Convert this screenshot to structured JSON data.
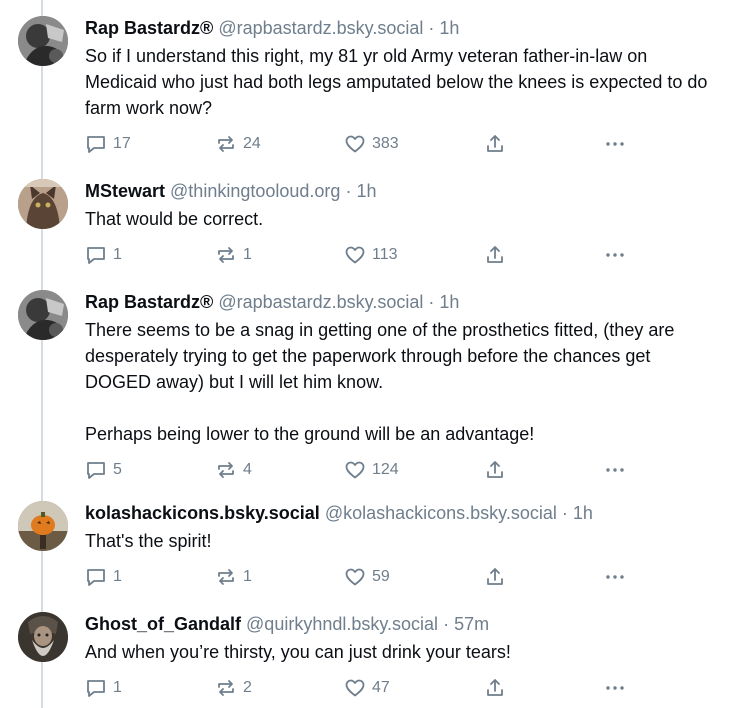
{
  "posts": [
    {
      "author": "Rap Bastardz®",
      "handle": "@rapbastardz.bsky.social",
      "time": "1h",
      "paragraphs": [
        "So if I understand this right, my 81 yr old Army veteran father-in-law on Medicaid who just had both legs amputated below the knees is expected to do farm work now?"
      ],
      "replies": "17",
      "reposts": "24",
      "likes": "383"
    },
    {
      "author": "MStewart",
      "handle": "@thinkingtooloud.org",
      "time": "1h",
      "paragraphs": [
        "That would be correct."
      ],
      "replies": "1",
      "reposts": "1",
      "likes": "113"
    },
    {
      "author": "Rap Bastardz®",
      "handle": "@rapbastardz.bsky.social",
      "time": "1h",
      "paragraphs": [
        "There seems to be a snag in getting one of the prosthetics fitted, (they are desperately trying to get the paperwork through before the chances get DOGED away) but I will let him know.",
        "Perhaps being lower to the ground will be an advantage!"
      ],
      "replies": "5",
      "reposts": "4",
      "likes": "124"
    },
    {
      "author": "kolashackicons.bsky.social",
      "handle": "@kolashackicons.bsky.social",
      "time": "1h",
      "paragraphs": [
        "That's the spirit!"
      ],
      "replies": "1",
      "reposts": "1",
      "likes": "59"
    },
    {
      "author": "Ghost_of_Gandalf",
      "handle": "@quirkyhndl.bsky.social",
      "time": "57m",
      "paragraphs": [
        "And when you’re thirsty, you can just drink your tears!"
      ],
      "replies": "1",
      "reposts": "2",
      "likes": "47"
    }
  ],
  "separator": "·",
  "icons": {
    "reply": "speech-bubble-icon",
    "repost": "repost-arrows-icon",
    "like": "heart-icon",
    "share": "share-upload-icon",
    "more": "more-ellipsis-icon"
  },
  "colors": {
    "text": "#0b0f14",
    "muted": "#6f7e8c",
    "thread": "#d4dbe2"
  }
}
